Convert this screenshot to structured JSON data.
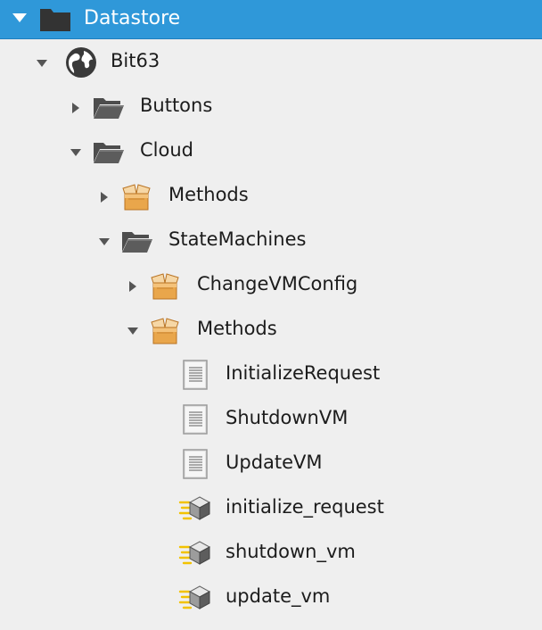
{
  "tree": {
    "root": {
      "label": "Datastore",
      "icon": "folder-icon",
      "expanded": true
    },
    "nodes": [
      {
        "label": "Bit63",
        "icon": "globe-icon",
        "level": 1,
        "toggle": "expanded"
      },
      {
        "label": "Buttons",
        "icon": "folder-icon",
        "level": 2,
        "toggle": "collapsed"
      },
      {
        "label": "Cloud",
        "icon": "folder-icon",
        "level": 2,
        "toggle": "expanded"
      },
      {
        "label": "Methods",
        "icon": "package-icon",
        "level": 3,
        "toggle": "collapsed"
      },
      {
        "label": "StateMachines",
        "icon": "folder-icon",
        "level": 3,
        "toggle": "expanded"
      },
      {
        "label": "ChangeVMConfig",
        "icon": "package-icon",
        "level": 4,
        "toggle": "collapsed"
      },
      {
        "label": "Methods",
        "icon": "package-icon",
        "level": 4,
        "toggle": "expanded"
      },
      {
        "label": "InitializeRequest",
        "icon": "document-icon",
        "level": 5,
        "toggle": "none"
      },
      {
        "label": "ShutdownVM",
        "icon": "document-icon",
        "level": 5,
        "toggle": "none"
      },
      {
        "label": "UpdateVM",
        "icon": "document-icon",
        "level": 5,
        "toggle": "none"
      },
      {
        "label": "initialize_request",
        "icon": "method-icon",
        "level": 5,
        "toggle": "none"
      },
      {
        "label": "shutdown_vm",
        "icon": "method-icon",
        "level": 5,
        "toggle": "none"
      },
      {
        "label": "update_vm",
        "icon": "method-icon",
        "level": 5,
        "toggle": "none"
      }
    ]
  },
  "colors": {
    "header": "#2f98d9",
    "background": "#efefef",
    "text": "#1c1c1c",
    "folder": "#4d4d4d",
    "package": "#e9a64b",
    "method_accent": "#f2c200"
  }
}
